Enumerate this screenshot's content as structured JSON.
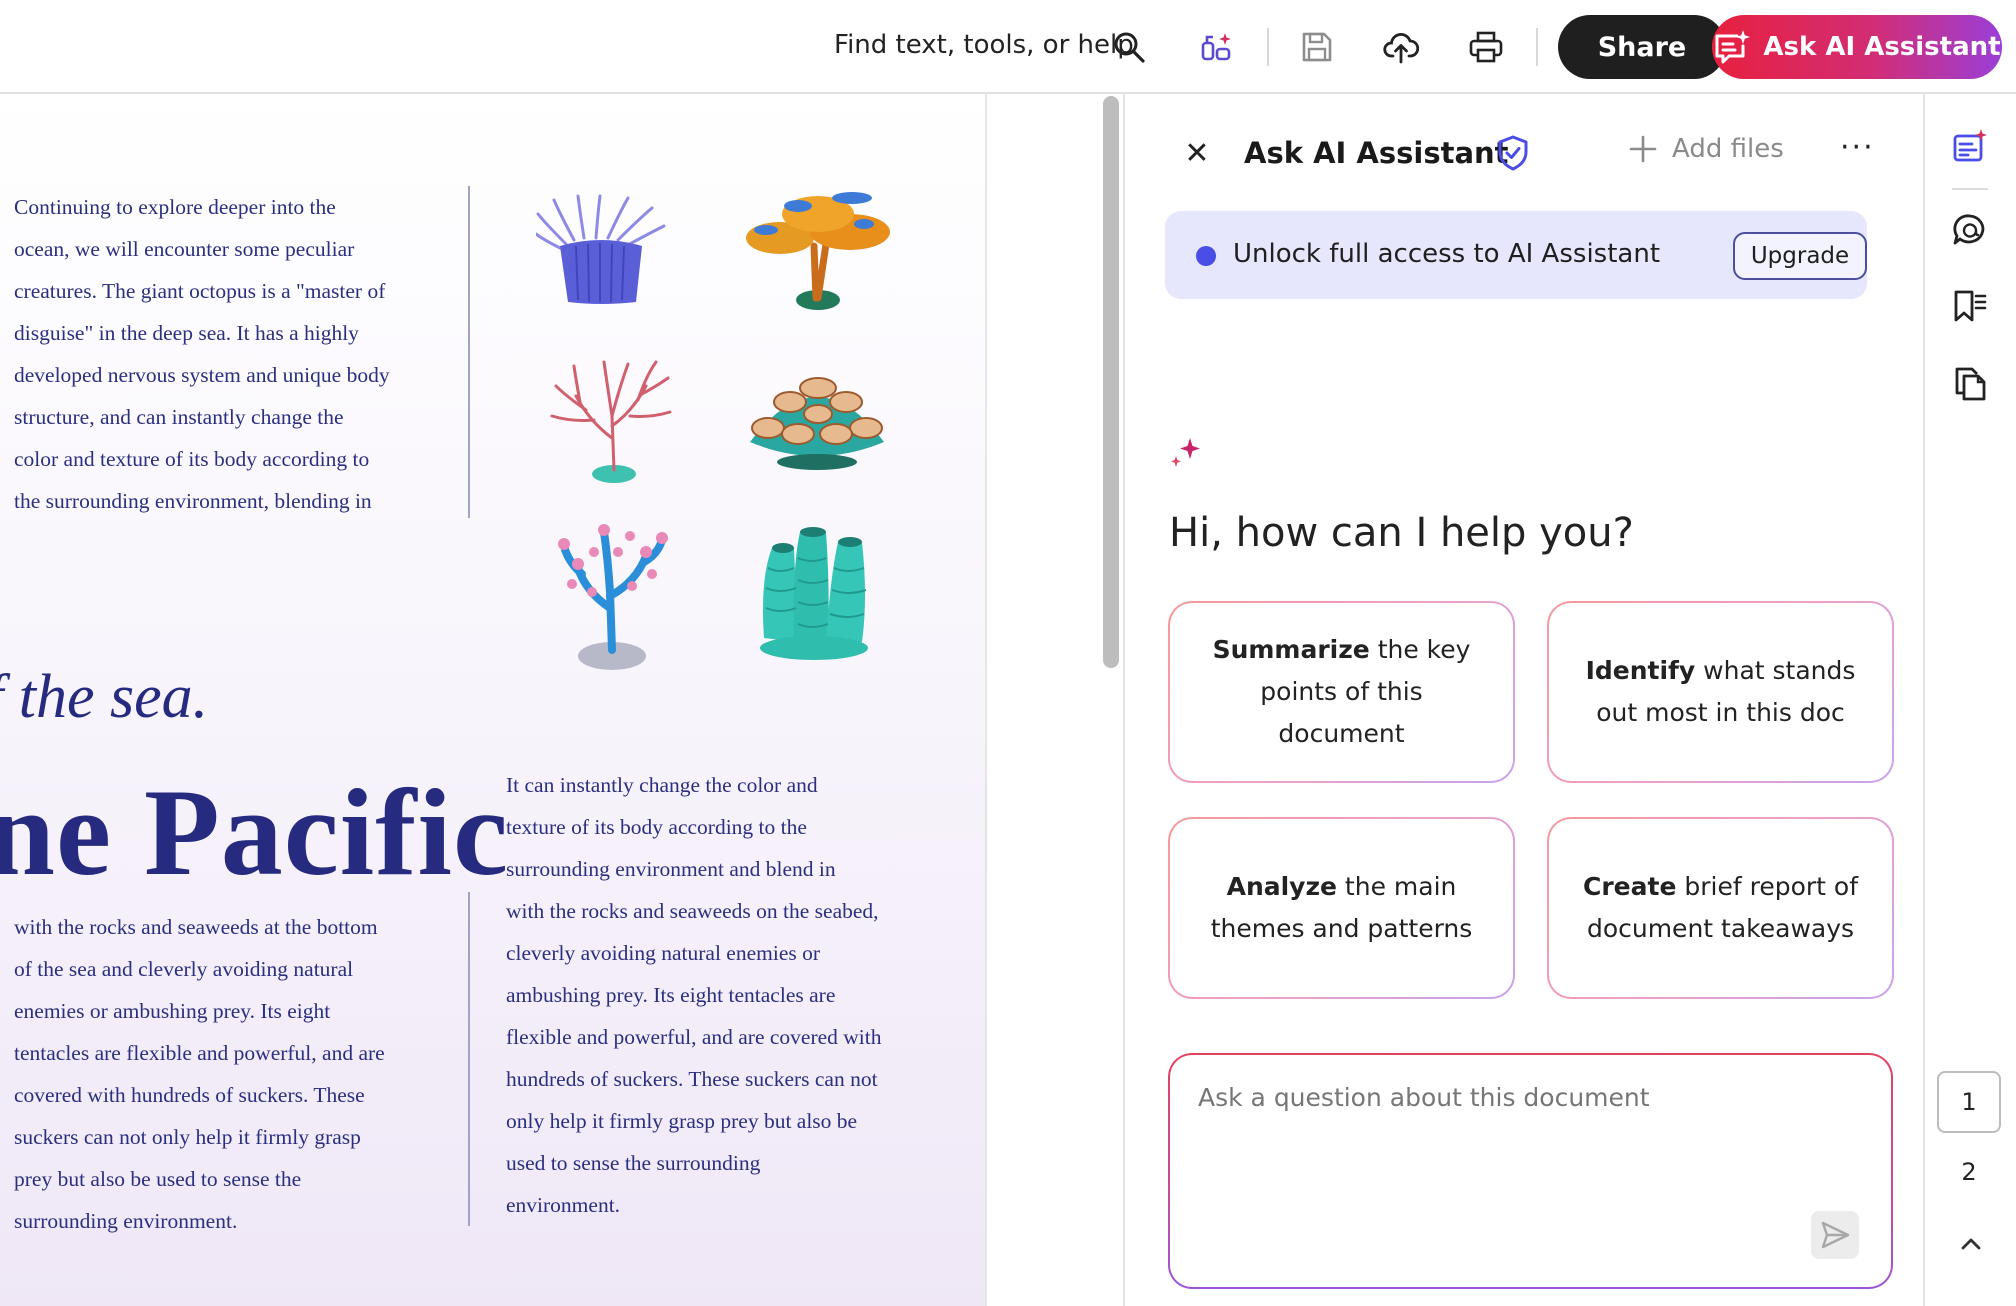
{
  "toolbar": {
    "search_label": "Find text, tools, or help",
    "share_label": "Share",
    "ask_ai_label": "Ask AI Assistant",
    "icons": [
      "search-icon",
      "ai-tools-icon",
      "save-icon",
      "upload-cloud-icon",
      "print-icon",
      "ai-assistant-icon"
    ]
  },
  "document": {
    "col1_top_lines": [
      "Continuing to explore deeper into the",
      "ocean, we will encounter some peculiar",
      "creatures. The giant octopus is a \"master of",
      "disguise\" in the deep sea. It has a highly",
      "developed nervous system and unique body",
      "structure, and can instantly change the",
      "color and texture of its body according to",
      "the surrounding environment, blending in"
    ],
    "heading_italic": "f the sea.",
    "heading_bold": "ne Pacific",
    "col1_bottom_lines": [
      "with the rocks and seaweeds at the bottom",
      "of the sea and cleverly avoiding natural",
      "enemies or ambushing prey. Its eight",
      "tentacles are flexible and powerful, and are",
      "covered with hundreds of suckers. These",
      "suckers can not only help it firmly grasp",
      "prey but also be used to sense the",
      "surrounding environment."
    ],
    "col2_lines": [
      "It can instantly change the color and",
      "texture of its body according to the",
      "surrounding environment and blend in",
      "with the rocks and seaweeds on the seabed,",
      "cleverly avoiding natural enemies or",
      "ambushing prey. Its eight tentacles are",
      "flexible and powerful, and are covered with",
      "hundreds of suckers. These suckers can not",
      "only help it firmly grasp prey but also be",
      "used to sense the surrounding",
      "environment."
    ]
  },
  "assistant": {
    "title": "Ask AI Assistant",
    "close_glyph": "✕",
    "add_files_label": "Add files",
    "more_glyph": "···",
    "banner_text": "Unlock full access to AI Assistant",
    "upgrade_label": "Upgrade",
    "greeting": "Hi, how can I help you?",
    "prompts": [
      {
        "bold": "Summarize",
        "rest_1": " the key",
        "line_2": "points of this document"
      },
      {
        "bold": "Identify",
        "rest_1": " what stands",
        "line_2": "out most in this doc"
      },
      {
        "bold": "Analyze",
        "rest_1": " the main",
        "line_2": "themes and patterns"
      },
      {
        "bold": "Create",
        "rest_1": " brief report of",
        "line_2": "document takeaways"
      }
    ],
    "input_placeholder": "Ask a question about this document"
  },
  "rail": {
    "icons": [
      "ai-summary-icon",
      "comment-icon",
      "bookmark-icon",
      "pages-icon"
    ],
    "page_current": "1",
    "page_next": "2"
  },
  "colors": {
    "ask_gradient_start": "#e8203f",
    "ask_gradient_end": "#9a3fd8",
    "doc_text": "#2a2f7f",
    "banner_bg": "#e6e6fc",
    "banner_dot": "#4b4ee6"
  }
}
